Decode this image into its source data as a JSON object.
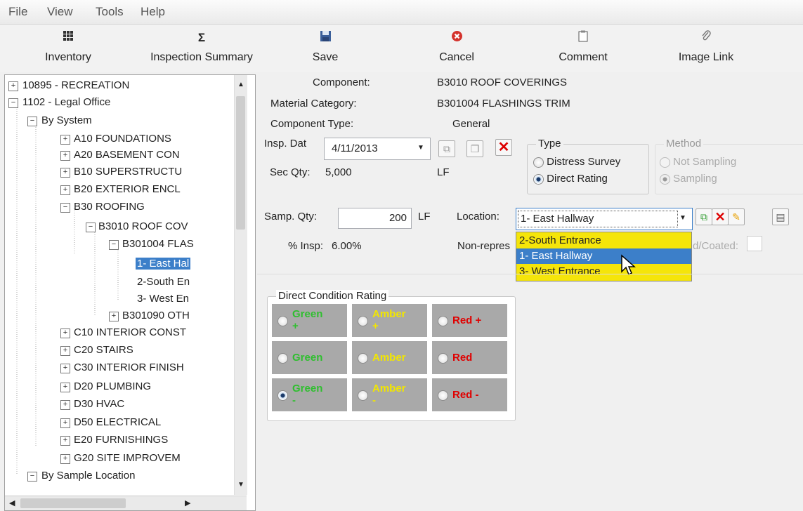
{
  "menu": [
    "File",
    "View",
    "Tools",
    "Help"
  ],
  "toolbar": {
    "inventory": {
      "label": "Inventory",
      "icon": "grid-icon"
    },
    "inspection_summary": {
      "label": "Inspection Summary",
      "icon": "sigma-icon"
    },
    "save": {
      "label": "Save",
      "icon": "floppy-disk-icon"
    },
    "cancel": {
      "label": "Cancel",
      "icon": "cancel-circle-icon"
    },
    "comment": {
      "label": "Comment",
      "icon": "clipboard-icon"
    },
    "image_link": {
      "label": "Image Link",
      "icon": "paperclip-icon"
    }
  },
  "tree": {
    "items": [
      {
        "label": "10895 - RECREATION",
        "expander": "+"
      },
      {
        "label": "1102 - Legal Office",
        "expander": "−"
      },
      {
        "label": "By System",
        "expander": "−"
      },
      {
        "label": "A10 FOUNDATIONS",
        "expander": "+"
      },
      {
        "label": "A20 BASEMENT CON",
        "expander": "+"
      },
      {
        "label": "B10 SUPERSTRUCTU",
        "expander": "+"
      },
      {
        "label": "B20 EXTERIOR ENCL",
        "expander": "+"
      },
      {
        "label": "B30 ROOFING",
        "expander": "−"
      },
      {
        "label": "B3010 ROOF COV",
        "expander": "−"
      },
      {
        "label": "B301004 FLAS",
        "expander": "−"
      },
      {
        "label": "1- East Hal",
        "expander": ""
      },
      {
        "label": "2-South En",
        "expander": ""
      },
      {
        "label": "3- West En",
        "expander": ""
      },
      {
        "label": "B301090 OTH",
        "expander": "+"
      },
      {
        "label": "C10 INTERIOR CONST",
        "expander": "+"
      },
      {
        "label": "C20 STAIRS",
        "expander": "+"
      },
      {
        "label": "C30 INTERIOR FINISH",
        "expander": "+"
      },
      {
        "label": "D20 PLUMBING",
        "expander": "+"
      },
      {
        "label": "D30 HVAC",
        "expander": "+"
      },
      {
        "label": "D50 ELECTRICAL",
        "expander": "+"
      },
      {
        "label": "E20 FURNISHINGS",
        "expander": "+"
      },
      {
        "label": "G20 SITE IMPROVEM",
        "expander": "+"
      },
      {
        "label": "By Sample Location",
        "expander": "−"
      }
    ],
    "selected": "1- East Hal"
  },
  "details": {
    "component_label": "Component:",
    "component_value": "B3010 ROOF COVERINGS",
    "material_label": "Material Category:",
    "material_value": "B301004 FLASHINGS  TRIM",
    "type_label": "Component Type:",
    "type_value": "General",
    "insp_date_label": "Insp. Dat",
    "insp_date_value": "4/11/2013",
    "sec_qty_label": "Sec Qty:",
    "sec_qty_value": "5,000",
    "sec_qty_unit": "LF",
    "samp_qty_label": "Samp. Qty:",
    "samp_qty_value": "200",
    "samp_qty_unit": "LF",
    "location_label": "Location:",
    "location_value": "1- East Hallway",
    "pct_insp_label": "% Insp:",
    "pct_insp_value": "6.00%",
    "nonrep_label": "Non-repres",
    "coated_label": "d/Coated:"
  },
  "type_group": {
    "title": "Type",
    "options": [
      "Distress Survey",
      "Direct Rating"
    ],
    "selected": "Direct Rating"
  },
  "method_group": {
    "title": "Method",
    "options": [
      "Not Sampling",
      "Sampling"
    ],
    "selected": "Sampling"
  },
  "location_dropdown": {
    "options": [
      "2-South Entrance",
      "1- East Hallway",
      "3- West Entrance"
    ],
    "highlighted": "1- East Hallway"
  },
  "rating": {
    "title": "Direct Condition Rating",
    "rows": [
      [
        {
          "line1": "Green",
          "line2": "+",
          "color": "#2fbf2f"
        },
        {
          "line1": "Amber",
          "line2": "+",
          "color": "#f2e600"
        },
        {
          "line1": "Red +",
          "line2": "",
          "color": "#e00000"
        }
      ],
      [
        {
          "line1": "Green",
          "line2": "",
          "color": "#2fbf2f"
        },
        {
          "line1": "Amber",
          "line2": "",
          "color": "#f2e600"
        },
        {
          "line1": "Red",
          "line2": "",
          "color": "#e00000"
        }
      ],
      [
        {
          "line1": "Green",
          "line2": "-",
          "color": "#2fbf2f"
        },
        {
          "line1": "Amber",
          "line2": "-",
          "color": "#f2e600"
        },
        {
          "line1": "Red -",
          "line2": "",
          "color": "#e00000"
        }
      ]
    ],
    "selected": "Green -"
  },
  "colors": {
    "selection": "#3c7fc9",
    "dropdown_bg": "#f5e50a",
    "grid_bg": "#a9a9a9"
  }
}
